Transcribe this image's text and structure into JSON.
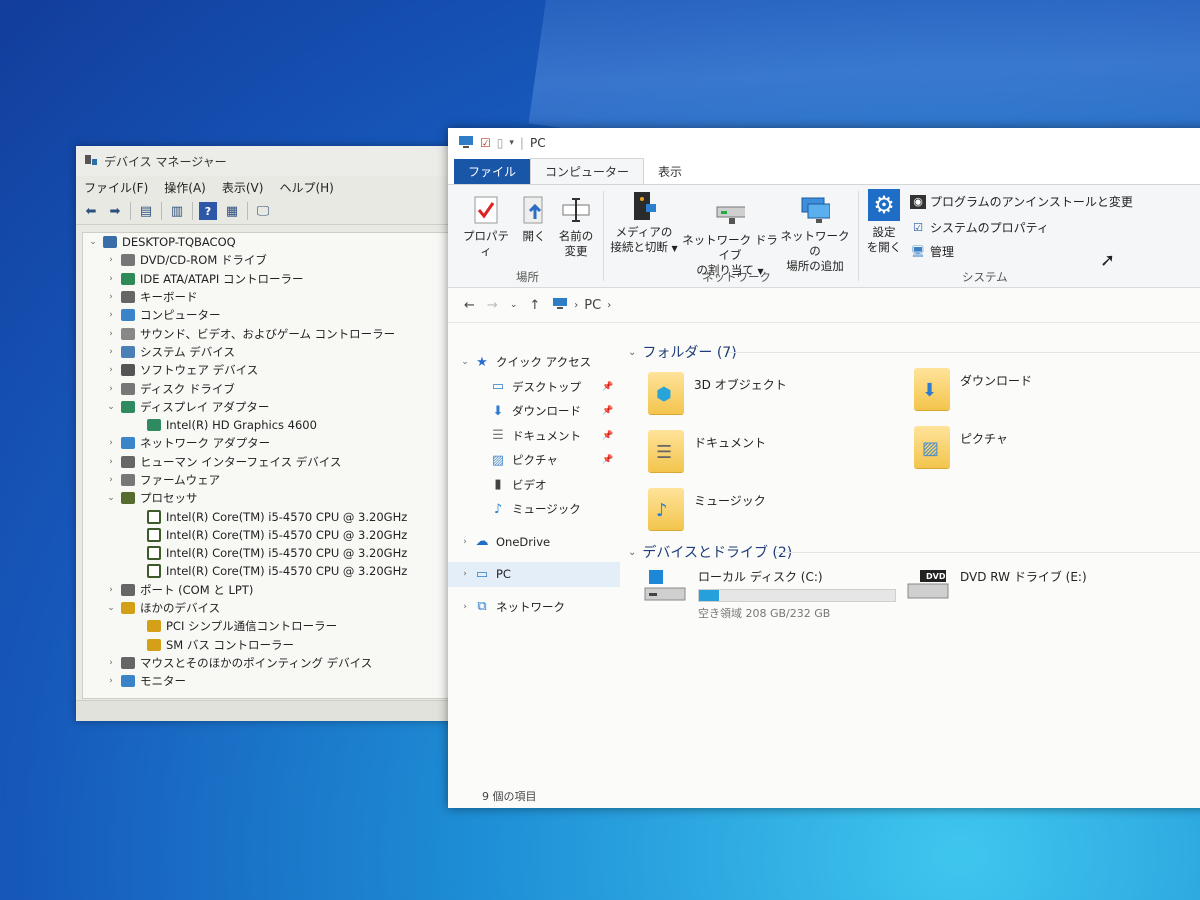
{
  "device_manager": {
    "title": "デバイス マネージャー",
    "menu": [
      "ファイル(F)",
      "操作(A)",
      "表示(V)",
      "ヘルプ(H)"
    ],
    "tree": [
      {
        "label": "DESKTOP-TQBACOQ",
        "level": 0,
        "expanded": true,
        "icon": "computer-icon"
      },
      {
        "label": "DVD/CD-ROM ドライブ",
        "level": 1,
        "expanded": false,
        "icon": "dvd-icon"
      },
      {
        "label": "IDE ATA/ATAPI コントローラー",
        "level": 1,
        "expanded": false,
        "icon": "controller-icon"
      },
      {
        "label": "キーボード",
        "level": 1,
        "expanded": false,
        "icon": "keyboard-icon"
      },
      {
        "label": "コンピューター",
        "level": 1,
        "expanded": false,
        "icon": "monitor-icon"
      },
      {
        "label": "サウンド、ビデオ、およびゲーム コントローラー",
        "level": 1,
        "expanded": false,
        "icon": "speaker-icon"
      },
      {
        "label": "システム デバイス",
        "level": 1,
        "expanded": false,
        "icon": "system-icon"
      },
      {
        "label": "ソフトウェア デバイス",
        "level": 1,
        "expanded": false,
        "icon": "software-icon"
      },
      {
        "label": "ディスク ドライブ",
        "level": 1,
        "expanded": false,
        "icon": "disk-icon"
      },
      {
        "label": "ディスプレイ アダプター",
        "level": 1,
        "expanded": true,
        "icon": "display-icon"
      },
      {
        "label": "Intel(R) HD Graphics 4600",
        "level": 2,
        "expanded": null,
        "icon": "display-icon"
      },
      {
        "label": "ネットワーク アダプター",
        "level": 1,
        "expanded": false,
        "icon": "network-icon"
      },
      {
        "label": "ヒューマン インターフェイス デバイス",
        "level": 1,
        "expanded": false,
        "icon": "hid-icon"
      },
      {
        "label": "ファームウェア",
        "level": 1,
        "expanded": false,
        "icon": "firmware-icon"
      },
      {
        "label": "プロセッサ",
        "level": 1,
        "expanded": true,
        "icon": "cpu-icon"
      },
      {
        "label": "Intel(R) Core(TM) i5-4570 CPU @ 3.20GHz",
        "level": 2,
        "expanded": null,
        "icon": "cpu-icon"
      },
      {
        "label": "Intel(R) Core(TM) i5-4570 CPU @ 3.20GHz",
        "level": 2,
        "expanded": null,
        "icon": "cpu-icon"
      },
      {
        "label": "Intel(R) Core(TM) i5-4570 CPU @ 3.20GHz",
        "level": 2,
        "expanded": null,
        "icon": "cpu-icon"
      },
      {
        "label": "Intel(R) Core(TM) i5-4570 CPU @ 3.20GHz",
        "level": 2,
        "expanded": null,
        "icon": "cpu-icon"
      },
      {
        "label": "ポート (COM と LPT)",
        "level": 1,
        "expanded": false,
        "icon": "port-icon"
      },
      {
        "label": "ほかのデバイス",
        "level": 1,
        "expanded": true,
        "icon": "warning-device-icon"
      },
      {
        "label": "PCI シンプル通信コントローラー",
        "level": 2,
        "expanded": null,
        "icon": "warning-device-icon"
      },
      {
        "label": "SM バス コントローラー",
        "level": 2,
        "expanded": null,
        "icon": "warning-device-icon"
      },
      {
        "label": "マウスとそのほかのポインティング デバイス",
        "level": 1,
        "expanded": false,
        "icon": "mouse-icon"
      },
      {
        "label": "モニター",
        "level": 1,
        "expanded": false,
        "icon": "monitor-icon"
      }
    ]
  },
  "explorer": {
    "title": "PC",
    "tabs": [
      "ファイル",
      "コンピューター",
      "表示"
    ],
    "ribbon": {
      "properties": "プロパティ",
      "open": "開く",
      "rename_1": "名前の",
      "rename_2": "変更",
      "media_1": "メディアの",
      "media_2": "接続と切断",
      "map_drive_1": "ネットワーク ドライブ",
      "map_drive_2": "の割り当て",
      "add_location_1": "ネットワークの",
      "add_location_2": "場所の追加",
      "settings_1": "設定",
      "settings_2": "を開く",
      "uninstall": "プログラムのアンインストールと変更",
      "sys_props": "システムのプロパティ",
      "manage": "管理",
      "group_location": "場所",
      "group_network": "ネットワーク",
      "group_system": "システム"
    },
    "address": {
      "path": "PC"
    },
    "nav": [
      {
        "label": "クイック アクセス",
        "indent": 0,
        "chev": "v",
        "icon": "star-icon",
        "pinned": false
      },
      {
        "label": "デスクトップ",
        "indent": 1,
        "chev": "",
        "icon": "desktop-icon",
        "pinned": true
      },
      {
        "label": "ダウンロード",
        "indent": 1,
        "chev": "",
        "icon": "download-icon",
        "pinned": true
      },
      {
        "label": "ドキュメント",
        "indent": 1,
        "chev": "",
        "icon": "document-icon",
        "pinned": true
      },
      {
        "label": "ピクチャ",
        "indent": 1,
        "chev": "",
        "icon": "picture-icon",
        "pinned": true
      },
      {
        "label": "ビデオ",
        "indent": 1,
        "chev": "",
        "icon": "video-icon",
        "pinned": false
      },
      {
        "label": "ミュージック",
        "indent": 1,
        "chev": "",
        "icon": "music-icon",
        "pinned": false
      },
      {
        "label": "OneDrive",
        "indent": 0,
        "chev": ">",
        "icon": "cloud-icon",
        "pinned": false
      },
      {
        "label": "PC",
        "indent": 0,
        "chev": ">",
        "icon": "pc-icon",
        "pinned": false
      },
      {
        "label": "ネットワーク",
        "indent": 0,
        "chev": ">",
        "icon": "network-icon",
        "pinned": false
      }
    ],
    "folders_header": "フォルダー (7)",
    "folders": [
      {
        "name": "3D オブジェクト",
        "icon": "3d-objects-icon"
      },
      {
        "name": "ダウンロード",
        "icon": "download-icon"
      },
      {
        "name": "ドキュメント",
        "icon": "document-icon"
      },
      {
        "name": "ピクチャ",
        "icon": "picture-icon"
      },
      {
        "name": "ミュージック",
        "icon": "music-icon"
      }
    ],
    "drives_header": "デバイスとドライブ (2)",
    "drives": [
      {
        "name": "ローカル ディスク (C:)",
        "space": "空き領域 208 GB/232 GB",
        "used_fraction": 0.1
      },
      {
        "name": "DVD RW ドライブ (E:)",
        "space": "",
        "badge": "DVD"
      }
    ],
    "status": "9 個の項目"
  },
  "colors": {
    "file_tab": "#1a56a8",
    "folder": "#f3c54d",
    "drive_bar": "#26a0da",
    "desktop": "#1e8fd6"
  }
}
